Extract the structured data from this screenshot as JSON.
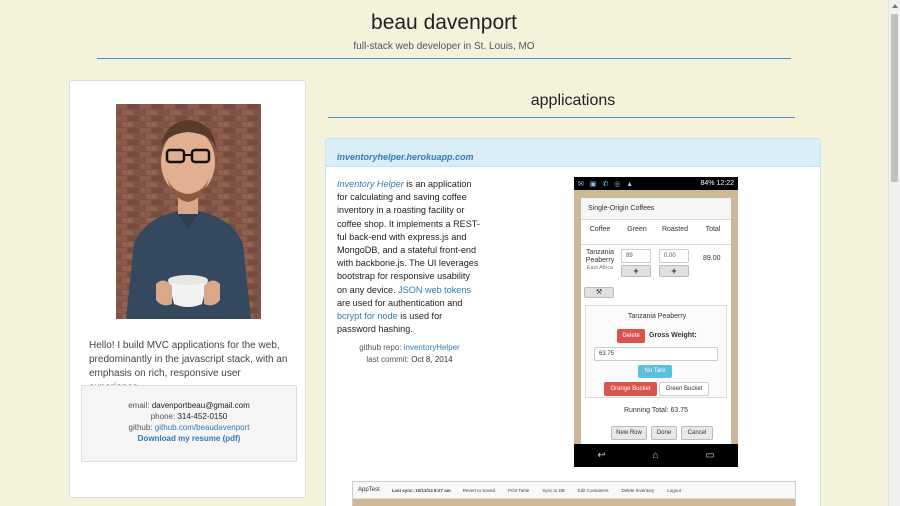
{
  "header": {
    "name": "beau davenport",
    "tagline": "full-stack web developer in St. Louis, MO"
  },
  "profile": {
    "bio": "Hello! I build MVC applications for the web, predominantly in the javascript stack, with an emphasis on rich, responsive user experience.",
    "email_label": "email:",
    "email": "davenportbeau@gmail.com",
    "phone_label": "phone:",
    "phone": "314-452-0150",
    "github_label": "github:",
    "github": "github.com/beaudavenport",
    "resume_link": "Download my resume (pdf)"
  },
  "applications": {
    "title": "applications",
    "project": {
      "url": "inventoryhelper.herokuapp.com",
      "name": "Inventory Helper",
      "desc_1": " is an application for calculating and saving coffee inventory in a roasting facility or coffee shop. It implements a REST-ful back-end with express.js and MongoDB, and a stateful front-end with backbone.js. The UI leverages bootstrap for responsive usability on any device. ",
      "link_jwt": "JSON web tokens",
      "desc_2": " are used for authentication and ",
      "link_bcrypt": "bcrypt for node",
      "desc_3": " is used for password hashing.",
      "repo_label": "github repo:",
      "repo": "inventoryHelper",
      "commit_label": "last commit:",
      "commit": "Oct 8, 2014"
    }
  },
  "phone_screen": {
    "status_right": "84%  12:22",
    "header": "Single-Origin Coffees",
    "columns": [
      "Coffee",
      "Green",
      "Roasted",
      "Total"
    ],
    "coffee_name": "Tanzania Peaberry",
    "coffee_origin": "East Africa",
    "green_value": "89",
    "roasted_value": "0.00",
    "total_value": "89.00",
    "plus": "+",
    "detail_title": "Tanzania Peaberry",
    "delete_btn": "Delete",
    "gross_label": "Gross Weight:",
    "gross_value": "63.75",
    "tare_btn": "No Tare",
    "orange_btn": "Orange Bucket",
    "green_btn": "Green Bucket",
    "running_total": "Running Total: 63.75",
    "new_row_btn": "New Row",
    "done_btn": "Done",
    "cancel_btn": "Cancel"
  },
  "desktop_screen": {
    "brand": "AppTest",
    "sync": "Last sync: 10/13/14 8:27 am",
    "nav": [
      "Revert to Saved",
      "Print Table",
      "Sync to DB",
      "Edit Containers",
      "Delete Inventory",
      "Logout"
    ]
  },
  "colors": {
    "background": "#f5f2dc",
    "accent": "#4a90c8",
    "link": "#337ab7",
    "danger": "#d9534f",
    "info": "#5bc0de"
  }
}
